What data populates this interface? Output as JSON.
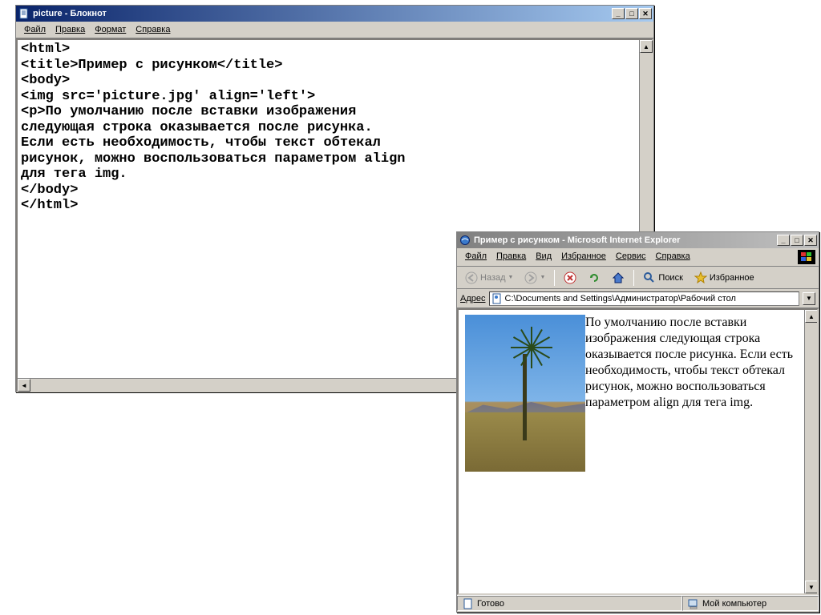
{
  "notepad": {
    "title": "picture - Блокнот",
    "menu": {
      "file": "Файл",
      "edit": "Правка",
      "format": "Формат",
      "help": "Справка"
    },
    "content": "<html>\n<title>Пример с рисунком</title>\n<body>\n<img src='picture.jpg' align='left'>\n<p>По умолчанию после вставки изображения\nследующая строка оказывается после рисунка.\nЕсли есть необходимость, чтобы текст обтекал\nрисунок, можно воспользоваться параметром align\nдля тега img.\n</body>\n</html>"
  },
  "ie": {
    "title": "Пример с рисунком - Microsoft Internet Explorer",
    "menu": {
      "file": "Файл",
      "edit": "Правка",
      "view": "Вид",
      "fav": "Избранное",
      "tools": "Сервис",
      "help": "Справка"
    },
    "toolbar": {
      "back": "Назад",
      "search": "Поиск",
      "favorites": "Избранное"
    },
    "address_label": "Адрес",
    "address_value": "C:\\Documents and Settings\\Администратор\\Рабочий стол",
    "page_text": "По умолчанию после вставки изображения следующая строка оказывается после рисунка. Если есть необходимость, чтобы текст обтекал рисунок, можно воспользоваться параметром align для тега img.",
    "status_left": "Готово",
    "status_right": "Мой компьютер"
  },
  "glyph": {
    "min": "_",
    "max": "□",
    "close": "✕",
    "left": "◄",
    "right": "►",
    "up": "▲",
    "down": "▼",
    "dot": "●"
  }
}
